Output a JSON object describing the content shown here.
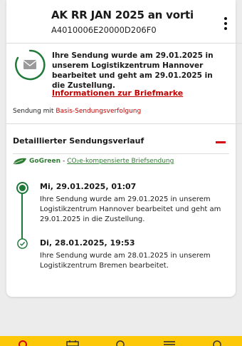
{
  "shipment": {
    "title": "AK RR JAN 2025 an vorti",
    "tracking_number": "A4010006E20000D206F0",
    "status_text": "Ihre Sendung wurde am 29.01.2025 in unserem Logistikzentrum Hannover bearbeitet und geht am 29.01.2025 in die Zustellung.",
    "stamp_link": "Informationen zur Briefmarke",
    "tracking_level_prefix": "Sendung mit",
    "tracking_level_link": "Basis-Sendungsverfolgung"
  },
  "details": {
    "header": "Detaillierter Sendungsverlauf",
    "gogreen_label": "GoGreen",
    "gogreen_dash": "-",
    "gogreen_link": "CO₂e-kompensierte Briefsendung",
    "events": [
      {
        "time": "Mi, 29.01.2025, 01:07",
        "text": "Ihre Sendung wurde am 29.01.2025 in unserem Logistikzentrum Hannover bearbeitet und geht am 29.01.2025 in die Zustellung."
      },
      {
        "time": "Di, 28.01.2025, 19:53",
        "text": "Ihre Sendung wurde am 28.01.2025 in unserem Logistikzentrum Bremen bearbeitet."
      }
    ]
  },
  "icons": {
    "status": "envelope-icon",
    "menu": "more-vertical-icon",
    "collapse": "minus-icon",
    "gogreen": "leaf-icon"
  },
  "colors": {
    "accent_red": "#d40511",
    "link_red": "#c10000",
    "green": "#1f7a3a",
    "dhl_yellow": "#fcc808"
  }
}
